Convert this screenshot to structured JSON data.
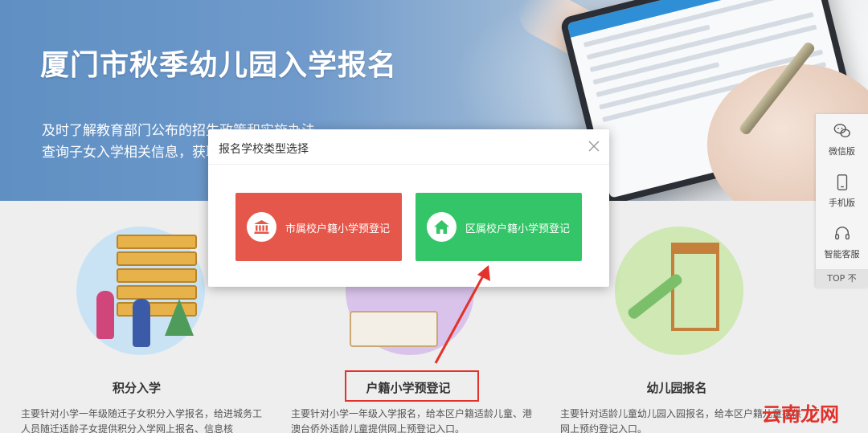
{
  "banner": {
    "title": "厦门市秋季幼儿园入学报名",
    "subtitle_line1": "及时了解教育部门公布的招生政策和实施办法，",
    "subtitle_line2": "查询子女入学相关信息，获取"
  },
  "features": [
    {
      "title": "积分入学",
      "desc": "主要针对小学一年级随迁子女积分入学报名，给进城务工人员随迁适龄子女提供积分入学网上报名、信息核"
    },
    {
      "title": "户籍小学预登记",
      "desc": "主要针对小学一年级入学报名，给本区户籍适龄儿童、港澳台侨外适龄儿童提供网上预登记入口。"
    },
    {
      "title": "幼儿园报名",
      "desc": "主要针对适龄儿童幼儿园入园报名，给本区户籍儿童提供网上预约登记入口。"
    }
  ],
  "modal": {
    "title": "报名学校类型选择",
    "options": [
      {
        "label": "市属校户籍小学预登记",
        "icon": "bank-building-icon",
        "color": "#e5574a"
      },
      {
        "label": "区属校户籍小学预登记",
        "icon": "home-icon",
        "color": "#33c567"
      }
    ]
  },
  "side_toolbar": {
    "items": [
      {
        "label": "微信版",
        "icon": "wechat-icon"
      },
      {
        "label": "手机版",
        "icon": "mobile-icon"
      },
      {
        "label": "智能客服",
        "icon": "headset-icon"
      }
    ],
    "top_label": "TOP 不"
  },
  "watermark": "云南龙网",
  "colors": {
    "annotation_red": "#e2322b",
    "banner_blue": "#6f9acb"
  }
}
